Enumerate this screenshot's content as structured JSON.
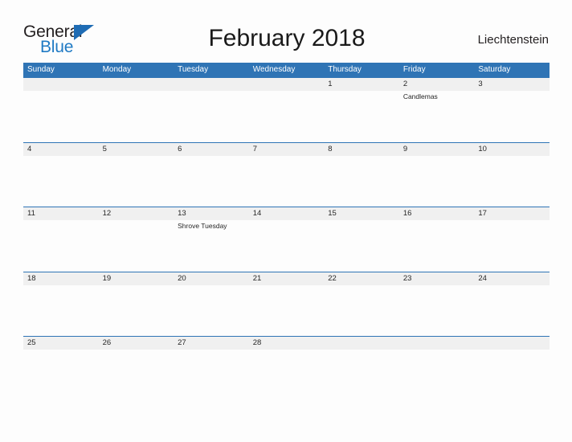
{
  "brand": {
    "name_part1": "General",
    "name_part2": "Blue",
    "triangle_icon": "triangle-icon",
    "color_dark": "#231f20",
    "color_blue": "#1f7ac4"
  },
  "header": {
    "title": "February 2018",
    "country": "Liechtenstein"
  },
  "calendar": {
    "header_bg": "#2f74b5",
    "band_bg": "#f0f0f0",
    "row_border": "#2f74b5",
    "weekdays": [
      "Sunday",
      "Monday",
      "Tuesday",
      "Wednesday",
      "Thursday",
      "Friday",
      "Saturday"
    ],
    "weeks": [
      [
        {
          "day": "",
          "event": ""
        },
        {
          "day": "",
          "event": ""
        },
        {
          "day": "",
          "event": ""
        },
        {
          "day": "",
          "event": ""
        },
        {
          "day": "1",
          "event": ""
        },
        {
          "day": "2",
          "event": "Candlemas"
        },
        {
          "day": "3",
          "event": ""
        }
      ],
      [
        {
          "day": "4",
          "event": ""
        },
        {
          "day": "5",
          "event": ""
        },
        {
          "day": "6",
          "event": ""
        },
        {
          "day": "7",
          "event": ""
        },
        {
          "day": "8",
          "event": ""
        },
        {
          "day": "9",
          "event": ""
        },
        {
          "day": "10",
          "event": ""
        }
      ],
      [
        {
          "day": "11",
          "event": ""
        },
        {
          "day": "12",
          "event": ""
        },
        {
          "day": "13",
          "event": "Shrove Tuesday"
        },
        {
          "day": "14",
          "event": ""
        },
        {
          "day": "15",
          "event": ""
        },
        {
          "day": "16",
          "event": ""
        },
        {
          "day": "17",
          "event": ""
        }
      ],
      [
        {
          "day": "18",
          "event": ""
        },
        {
          "day": "19",
          "event": ""
        },
        {
          "day": "20",
          "event": ""
        },
        {
          "day": "21",
          "event": ""
        },
        {
          "day": "22",
          "event": ""
        },
        {
          "day": "23",
          "event": ""
        },
        {
          "day": "24",
          "event": ""
        }
      ],
      [
        {
          "day": "25",
          "event": ""
        },
        {
          "day": "26",
          "event": ""
        },
        {
          "day": "27",
          "event": ""
        },
        {
          "day": "28",
          "event": ""
        },
        {
          "day": "",
          "event": ""
        },
        {
          "day": "",
          "event": ""
        },
        {
          "day": "",
          "event": ""
        }
      ]
    ]
  }
}
